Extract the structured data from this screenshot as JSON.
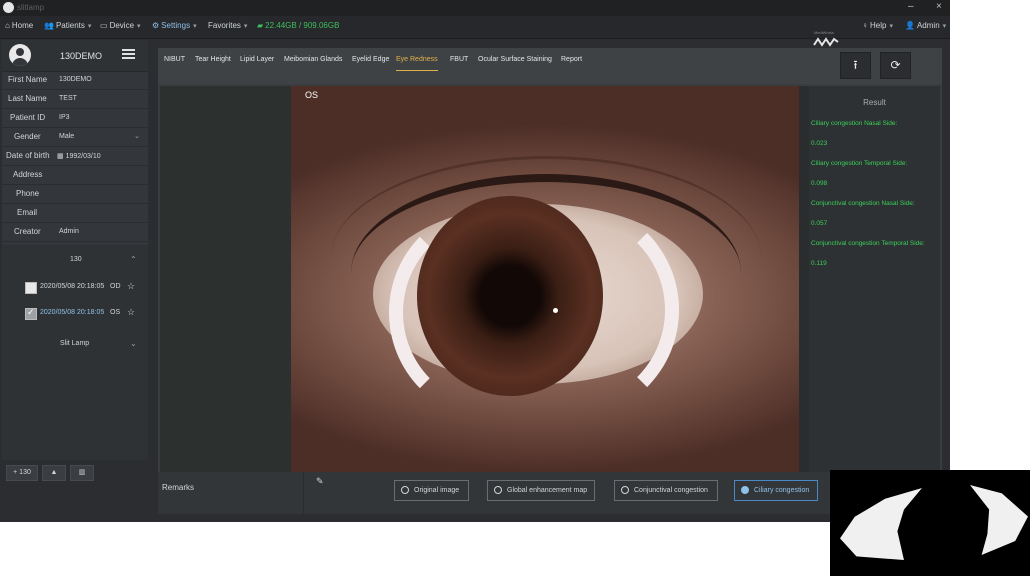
{
  "titlebar": {
    "app_title": "slitlamp",
    "min": "–",
    "close": "×"
  },
  "menubar": {
    "home": "Home",
    "patients": "Patients",
    "device": "Device",
    "settings": "Settings",
    "favorites": "Favorites",
    "storage": "22.44GB / 909.06GB",
    "help": "Help",
    "admin": "Admin",
    "brand_sub": "MediWorks"
  },
  "patient": {
    "name_header": "130DEMO",
    "fields": [
      {
        "label": "First Name",
        "value": "130DEMO"
      },
      {
        "label": "Last Name",
        "value": "TEST"
      },
      {
        "label": "Patient ID",
        "value": "IP3"
      },
      {
        "label": "Gender",
        "value": "Male"
      },
      {
        "label": "Date of birth",
        "value": "1992/03/10"
      },
      {
        "label": "Address",
        "value": ""
      },
      {
        "label": "Phone",
        "value": ""
      },
      {
        "label": "Email",
        "value": ""
      },
      {
        "label": "Creator",
        "value": "Admin"
      }
    ]
  },
  "records": {
    "group": "130",
    "items": [
      {
        "datetime": "2020/05/08 20:18:05",
        "eye": "OD",
        "checked": false
      },
      {
        "datetime": "2020/05/08 20:18:05",
        "eye": "OS",
        "checked": true
      }
    ],
    "slit_lamp": "Slit Lamp"
  },
  "leftfoot": {
    "add": "+ 130",
    "up": "▲",
    "del": "🗑"
  },
  "tabs": [
    "NIBUT",
    "Tear Height",
    "Lipid Layer",
    "Meibomian Glands",
    "Eyelid Edge",
    "Eye Redness",
    "FBUT",
    "Ocular Surface Staining",
    "Report"
  ],
  "active_tab": "Eye Redness",
  "viewer": {
    "eye_label": "OS"
  },
  "result": {
    "title": "Result",
    "items": [
      {
        "label": "Ciliary congestion Nasal Side:",
        "value": "0.023"
      },
      {
        "label": "Ciliary congestion Temporal Side:",
        "value": "0.098"
      },
      {
        "label": "Conjunctival congestion Nasal Side:",
        "value": "0.057"
      },
      {
        "label": "Conjunctival congestion Temporal Side:",
        "value": "0.119"
      }
    ],
    "color": "#3ad05a"
  },
  "bottom": {
    "remarks": "Remarks",
    "options": [
      "Original image",
      "Global enhancement map",
      "Conjunctival congestion",
      "Ciliary congestion"
    ],
    "selected": "Ciliary congestion"
  },
  "icons": {
    "upload": "upload-icon",
    "refresh": "refresh-icon",
    "edit": "pencil-icon"
  }
}
